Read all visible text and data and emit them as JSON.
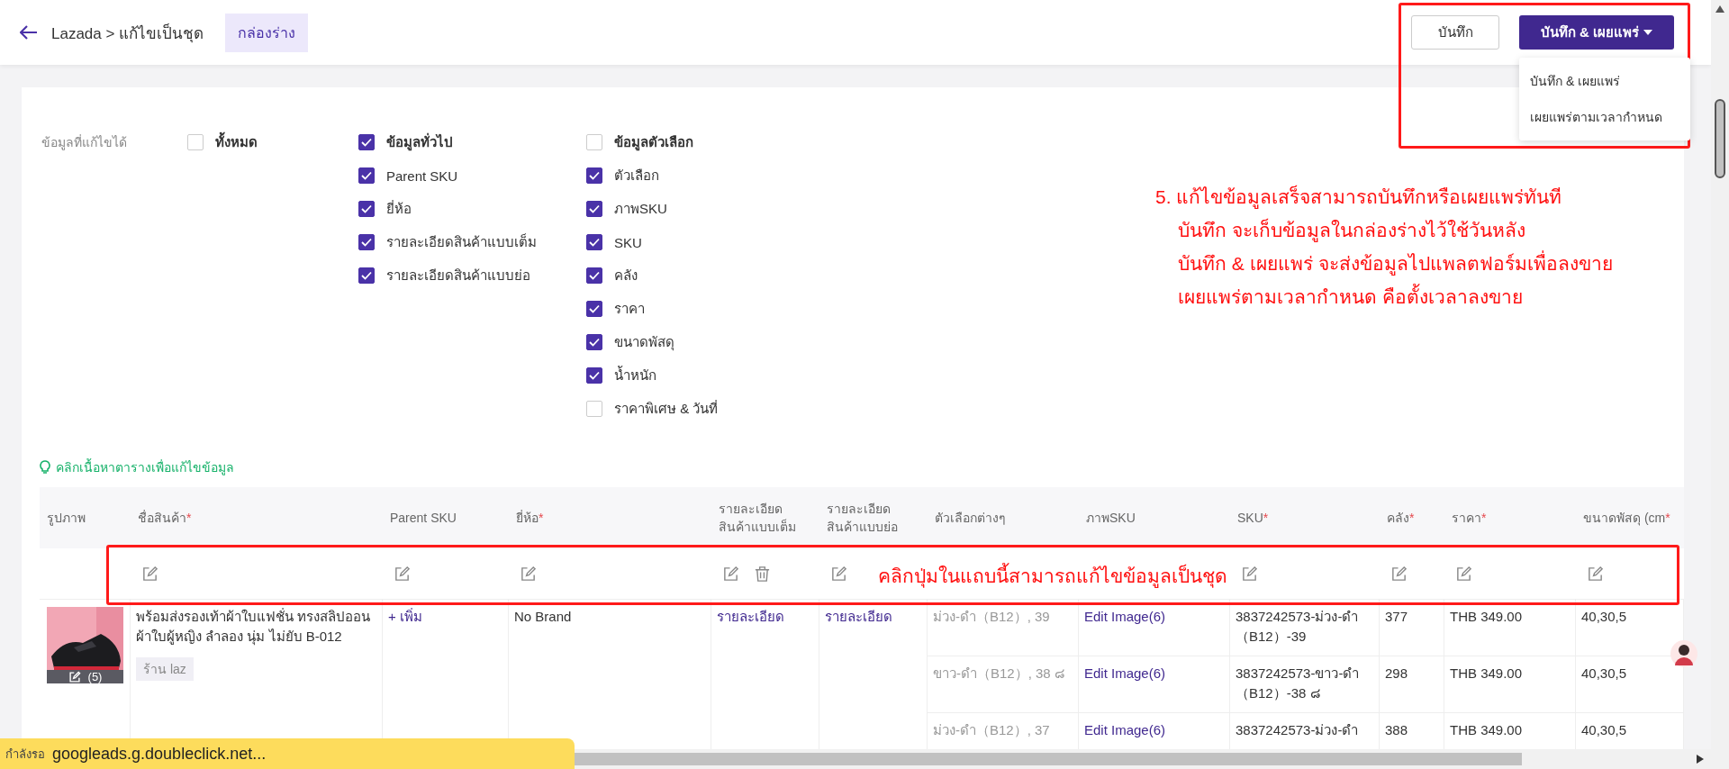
{
  "header": {
    "breadcrumb": "Lazada > แก้ไขเป็นชุด",
    "status_badge": "กล่องร่าง"
  },
  "buttons": [
    {
      "label": "บันทึก",
      "kind": "outline"
    },
    {
      "label": "บันทึก & เผยแพร่",
      "kind": "primary"
    }
  ],
  "dropdown_menu": [
    "บันทึก & เผยแพร่",
    "เผยแพร่ตามเวลากำหนด"
  ],
  "editable_fields": {
    "label": "ข้อมูลที่แก้ไขได้",
    "groups": [
      {
        "label": "ทั้งหมด",
        "checked": false
      },
      {
        "label": "ข้อมูลทั่วไป",
        "checked": true,
        "items": [
          {
            "label": "Parent SKU",
            "checked": true
          },
          {
            "label": "ยี่ห้อ",
            "checked": true
          },
          {
            "label": "รายละเอียดสินค้าแบบเต็ม",
            "checked": true
          },
          {
            "label": "รายละเอียดสินค้าแบบย่อ",
            "checked": true
          }
        ]
      },
      {
        "label": "ข้อมูลตัวเลือก",
        "checked": false,
        "items": [
          {
            "label": "ตัวเลือก",
            "checked": true
          },
          {
            "label": "ภาพSKU",
            "checked": true
          },
          {
            "label": "SKU",
            "checked": true
          },
          {
            "label": "คลัง",
            "checked": true
          },
          {
            "label": "ราคา",
            "checked": true
          },
          {
            "label": "ขนาดพัสดุ",
            "checked": true
          },
          {
            "label": "น้ำหนัก",
            "checked": true
          },
          {
            "label": "ราคาพิเศษ & วันที่",
            "checked": false
          }
        ]
      }
    ]
  },
  "hint": "คลิกเนื้อหาตารางเพื่อแก้ไขข้อมูล",
  "table": {
    "columns": [
      {
        "label": "รูปภาพ"
      },
      {
        "label": "ชื่อสินค้า",
        "required_mark": "*",
        "bulk_edit": true
      },
      {
        "label": "Parent SKU",
        "bulk_edit": true
      },
      {
        "label": "ยี่ห้อ",
        "required_mark": "*",
        "bulk_edit": true
      },
      {
        "label": "รายละเอียด\nสินค้าแบบเต็ม",
        "bulk_edit": true,
        "bulk_delete": true
      },
      {
        "label": "รายละเอียด\nสินค้าแบบย่อ",
        "bulk_edit": true
      },
      {
        "label": "ตัวเลือกต่างๆ"
      },
      {
        "label": "ภาพSKU"
      },
      {
        "label": "SKU",
        "required_mark": "*",
        "bulk_edit": true
      },
      {
        "label": "คลัง",
        "required_mark": "*",
        "bulk_edit": true
      },
      {
        "label": "ราคา",
        "required_mark": "*",
        "bulk_edit": true
      },
      {
        "label": "ขนาดพัสดุ (cm",
        "required_mark": "*",
        "bulk_edit": true
      }
    ],
    "rows": [
      {
        "image_count": "(5)",
        "name": "พร้อมส่งรองเท้าผ้าใบแฟชั่น ทรงสลิปออน ผ้าใบผู้หญิง ลำลอง นุ่ม ไม่ยับ B-012",
        "shop_tag": "ร้าน laz",
        "parent_sku": "+ เพิ่ม",
        "brand": "No Brand",
        "full_detail": "รายละเอียด",
        "short_detail": "รายละเอียด",
        "variants": [
          {
            "option": "ม่วง-ดำ（B12）, 39",
            "image": "Edit Image(6)",
            "sku": "3837242573-ม่วง-ดำ（B12）-39",
            "stock": "377",
            "price": "THB 349.00",
            "size": "40,30,5"
          },
          {
            "option": "ขาว-ดำ（B12）, 38 ๘",
            "image": "Edit Image(6)",
            "sku": "3837242573-ขาว-ดำ（B12）-38 ๘",
            "stock": "298",
            "price": "THB 349.00",
            "size": "40,30,5"
          },
          {
            "option": "ม่วง-ดำ（B12）, 37",
            "image": "Edit Image(6)",
            "sku": "3837242573-ม่วง-ดำ",
            "stock": "388",
            "price": "THB 349.00",
            "size": "40,30,5"
          }
        ]
      }
    ]
  },
  "annotations": {
    "lines": [
      "5. แก้ไขข้อมูลเสร็จสามารถบันทึกหรือเผยแพร่ทันที",
      "บันทึก จะเก็บข้อมูลในกล่องร่างไว้ใช้วันหลัง",
      "บันทึก & เผยแพร่ จะส่งข้อมูลไปแพลตฟอร์มเพื่อลงขาย",
      "เผยแพร่ตามเวลากำหนด คือตั้งเวลาลงขาย"
    ],
    "table_note": "คลิกปุ่มในแถบนี้สามารถแก้ไขข้อมูลเป็นชุด"
  },
  "loading_status": {
    "label": "กำลังรอ",
    "url": "googleads.g.doubleclick.net..."
  }
}
